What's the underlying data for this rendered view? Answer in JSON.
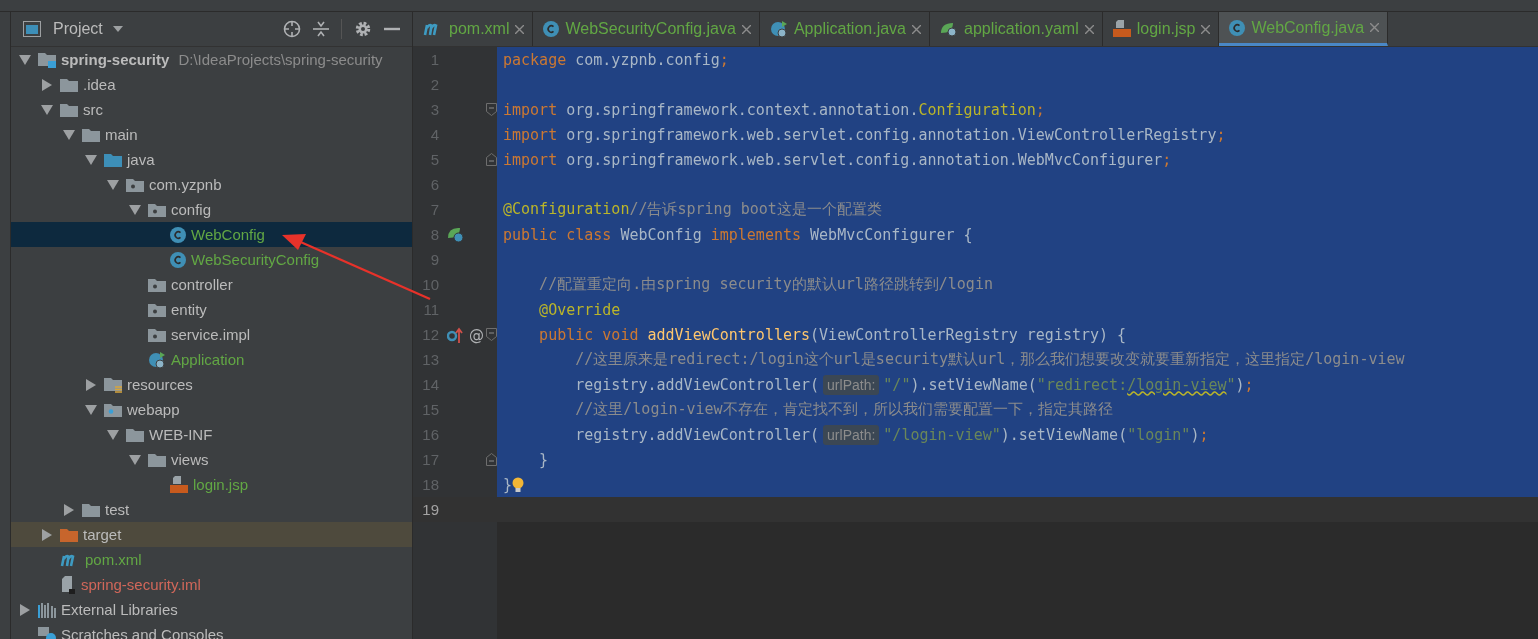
{
  "project_panel": {
    "title": "Project",
    "tree": [
      {
        "label": "spring-security",
        "path": "D:\\IdeaProjects\\spring-security",
        "kind": "module",
        "selected": false,
        "expanded": true,
        "children": [
          {
            "label": ".idea",
            "kind": "folder",
            "selected": false,
            "expanded": false
          },
          {
            "label": "src",
            "kind": "folder",
            "selected": false,
            "expanded": true,
            "children": [
              {
                "label": "main",
                "kind": "folder",
                "selected": false,
                "expanded": true,
                "children": [
                  {
                    "label": "java",
                    "kind": "source-folder",
                    "selected": false,
                    "expanded": true,
                    "children": [
                      {
                        "label": "com.yzpnb",
                        "kind": "package",
                        "selected": false,
                        "expanded": true,
                        "children": [
                          {
                            "label": "config",
                            "kind": "package",
                            "selected": false,
                            "expanded": true,
                            "children": [
                              {
                                "label": "WebConfig",
                                "kind": "class",
                                "color": "#62a744",
                                "selected": true
                              },
                              {
                                "label": "WebSecurityConfig",
                                "kind": "class",
                                "color": "#62a744",
                                "selected": false
                              }
                            ]
                          },
                          {
                            "label": "controller",
                            "kind": "package",
                            "selected": false
                          },
                          {
                            "label": "entity",
                            "kind": "package",
                            "selected": false
                          },
                          {
                            "label": "service.impl",
                            "kind": "package",
                            "selected": false
                          },
                          {
                            "label": "Application",
                            "kind": "spring-app",
                            "color": "#62a744",
                            "selected": false
                          }
                        ]
                      }
                    ]
                  },
                  {
                    "label": "resources",
                    "kind": "resources-folder",
                    "selected": false,
                    "expanded": false
                  },
                  {
                    "label": "webapp",
                    "kind": "web-folder",
                    "selected": false,
                    "expanded": true,
                    "children": [
                      {
                        "label": "WEB-INF",
                        "kind": "folder",
                        "selected": false,
                        "expanded": true,
                        "children": [
                          {
                            "label": "views",
                            "kind": "folder",
                            "selected": false,
                            "expanded": true,
                            "children": [
                              {
                                "label": "login.jsp",
                                "kind": "jsp",
                                "color": "#62a744",
                                "selected": false
                              }
                            ]
                          }
                        ]
                      }
                    ]
                  }
                ]
              },
              {
                "label": "test",
                "kind": "folder",
                "selected": false,
                "expanded": false
              }
            ]
          },
          {
            "label": "target",
            "kind": "excluded-folder",
            "selected": false,
            "expanded": false
          },
          {
            "label": "pom.xml",
            "kind": "maven",
            "color": "#62a744",
            "selected": false
          },
          {
            "label": "spring-security.iml",
            "kind": "iml",
            "color": "#d1675a",
            "selected": false
          }
        ]
      },
      {
        "label": "External Libraries",
        "kind": "libraries",
        "selected": false,
        "expanded": false
      },
      {
        "label": "Scratches and Consoles",
        "kind": "scratches",
        "selected": false
      }
    ]
  },
  "editor": {
    "tabs": [
      {
        "label": "pom.xml",
        "kind": "maven",
        "color": "#62a744",
        "selected": false
      },
      {
        "label": "WebSecurityConfig.java",
        "kind": "class",
        "color": "#62a744",
        "selected": false
      },
      {
        "label": "Application.java",
        "kind": "spring-app",
        "color": "#62a744",
        "selected": false
      },
      {
        "label": "application.yaml",
        "kind": "yaml",
        "color": "#62a744",
        "selected": false
      },
      {
        "label": "login.jsp",
        "kind": "jsp",
        "color": "#62a744",
        "selected": false
      },
      {
        "label": "WebConfig.java",
        "kind": "class",
        "color": "#62a744",
        "selected": true
      }
    ],
    "lines": [
      {
        "number": "1",
        "selected": true,
        "tokens": [
          {
            "kind": "keyword",
            "text": "package"
          },
          {
            "kind": "plain",
            "text": " com.yzpnb.config"
          },
          {
            "kind": "keyword",
            "text": ";"
          }
        ]
      },
      {
        "number": "2",
        "selected": true
      },
      {
        "number": "3",
        "selected": true,
        "fold_start": true,
        "tokens": [
          {
            "kind": "keyword",
            "text": "import"
          },
          {
            "kind": "plain",
            "text": " org.springframework.context.annotation."
          },
          {
            "kind": "annotation",
            "text": "Configuration"
          },
          {
            "kind": "keyword",
            "text": ";"
          }
        ]
      },
      {
        "number": "4",
        "selected": true,
        "tokens": [
          {
            "kind": "keyword",
            "text": "import"
          },
          {
            "kind": "plain",
            "text": " org.springframework.web.servlet.config.annotation.ViewControllerRegistry"
          },
          {
            "kind": "keyword",
            "text": ";"
          }
        ]
      },
      {
        "number": "5",
        "selected": true,
        "fold_end": true,
        "tokens": [
          {
            "kind": "keyword",
            "text": "import"
          },
          {
            "kind": "plain",
            "text": " org.springframework.web.servlet.config.annotation.WebMvcConfigurer"
          },
          {
            "kind": "keyword",
            "text": ";"
          }
        ]
      },
      {
        "number": "6",
        "selected": true
      },
      {
        "number": "7",
        "selected": true,
        "tokens": [
          {
            "kind": "annotation",
            "text": "@Configuration"
          },
          {
            "kind": "comment",
            "text": "//告诉spring boot这是一个配置类"
          }
        ]
      },
      {
        "number": "8",
        "selected": true,
        "bean_marker": true,
        "tokens": [
          {
            "kind": "keyword",
            "text": "public class"
          },
          {
            "kind": "plain",
            "text": " WebConfig "
          },
          {
            "kind": "keyword",
            "text": "implements"
          },
          {
            "kind": "plain",
            "text": " WebMvcConfigurer {"
          }
        ]
      },
      {
        "number": "9",
        "selected": true
      },
      {
        "number": "10",
        "selected": true,
        "tokens": [
          {
            "kind": "comment",
            "text": "    //配置重定向.由spring security的默认url路径跳转到/login"
          }
        ]
      },
      {
        "number": "11",
        "selected": true,
        "tokens": [
          {
            "kind": "annotation",
            "text": "    @Override"
          }
        ]
      },
      {
        "number": "12",
        "selected": true,
        "implements_marker": true,
        "gutter_mark": "@",
        "fold_start": true,
        "tokens": [
          {
            "kind": "keyword",
            "text": "    public void "
          },
          {
            "kind": "method",
            "text": "addViewControllers"
          },
          {
            "kind": "plain",
            "text": "(ViewControllerRegistry registry) {"
          }
        ]
      },
      {
        "number": "13",
        "selected": true,
        "tokens": [
          {
            "kind": "comment",
            "text": "        //这里原来是redirect:/login这个url是security默认url，那么我们想要改变就要重新指定，这里指定/login-view"
          }
        ]
      },
      {
        "number": "14",
        "selected": true,
        "tokens": [
          {
            "kind": "plain",
            "text": "        registry.addViewController("
          },
          {
            "kind": "hint",
            "text": "urlPath:"
          },
          {
            "kind": "string",
            "text": "\"/\""
          },
          {
            "kind": "plain",
            "text": ").setViewName("
          },
          {
            "kind": "string",
            "text": "\"redirect:"
          },
          {
            "kind": "string-typo",
            "text": "/login-view"
          },
          {
            "kind": "string",
            "text": "\""
          },
          {
            "kind": "plain",
            "text": ")"
          },
          {
            "kind": "keyword",
            "text": ";"
          }
        ]
      },
      {
        "number": "15",
        "selected": true,
        "tokens": [
          {
            "kind": "comment",
            "text": "        //这里/login-view不存在，肯定找不到，所以我们需要配置一下，指定其路径"
          }
        ]
      },
      {
        "number": "16",
        "selected": true,
        "tokens": [
          {
            "kind": "plain",
            "text": "        registry.addViewController("
          },
          {
            "kind": "hint",
            "text": "urlPath:"
          },
          {
            "kind": "string",
            "text": "\"/login-view\""
          },
          {
            "kind": "plain",
            "text": ").setViewName("
          },
          {
            "kind": "string",
            "text": "\"login\""
          },
          {
            "kind": "plain",
            "text": ")"
          },
          {
            "kind": "keyword",
            "text": ";"
          }
        ]
      },
      {
        "number": "17",
        "selected": true,
        "fold_end": true,
        "tokens": [
          {
            "kind": "plain",
            "text": "    }"
          }
        ]
      },
      {
        "number": "18",
        "selected": true,
        "bulb": true,
        "tokens": [
          {
            "kind": "plain",
            "text": "}"
          }
        ]
      },
      {
        "number": "19",
        "selected": false,
        "current": true
      }
    ]
  }
}
